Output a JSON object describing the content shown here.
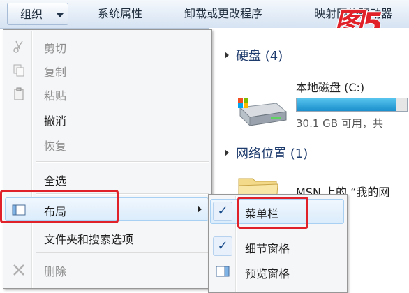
{
  "toolbar": {
    "organize_label": "组织",
    "system_properties_label": "系统属性",
    "uninstall_label": "卸载或更改程序",
    "map_drive_label": "映射网络驱动器",
    "figure_tag": "图5"
  },
  "content": {
    "hard_disk_header": "硬盘 (4)",
    "drive_name": "本地磁盘 (C:)",
    "drive_usage_fraction": 0.9,
    "drive_free_text": "30.1 GB 可用，共",
    "network_header": "网络位置 (1)",
    "network_item_name": "MSN 上的 “我的网"
  },
  "menu": {
    "cut": "剪切",
    "copy": "复制",
    "paste": "粘贴",
    "undo": "撤消",
    "redo": "恢复",
    "select_all": "全选",
    "layout": "布局",
    "folder_options": "文件夹和搜索选项",
    "delete": "删除"
  },
  "submenu": {
    "menu_bar": "菜单栏",
    "details_pane": "细节窗格",
    "preview_pane": "预览窗格",
    "check_glyph": "✓"
  },
  "colors": {
    "annotation_red": "#e0212a",
    "drive_bar_blue": "#1b8fcc"
  }
}
